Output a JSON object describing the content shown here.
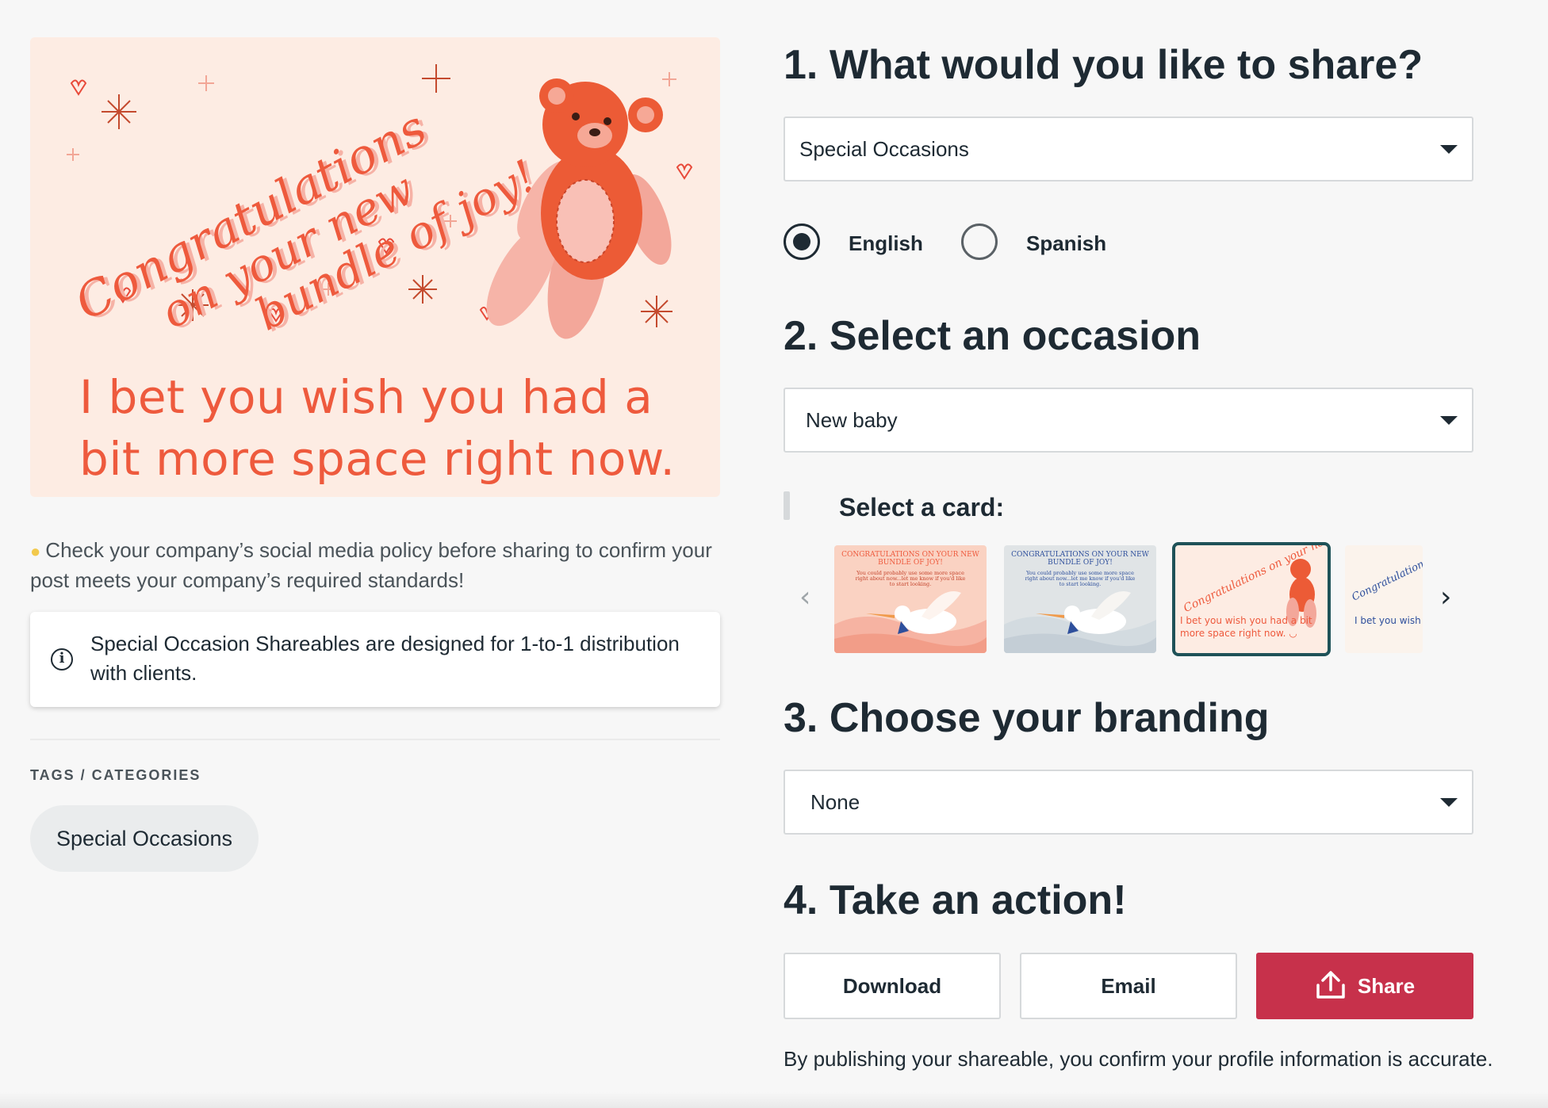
{
  "preview": {
    "headline_lines": [
      "Congratulations",
      "on your new",
      "bundle of joy!"
    ],
    "message": "I bet you wish you had a bit more space right now. ◡"
  },
  "tip": {
    "icon": "lightbulb-icon",
    "text": "Check your company’s social media policy before sharing to confirm your post meets your company’s required standards!"
  },
  "notice": {
    "icon": "info-icon",
    "text": "Special Occasion Shareables are designed for 1-to-1 distribution with clients."
  },
  "tags": {
    "label": "TAGS / CATEGORIES",
    "items": [
      "Special Occasions"
    ]
  },
  "steps": {
    "step1": {
      "heading": "1. What would you like to share?",
      "selected": "Special Occasions",
      "languages": [
        {
          "label": "English",
          "checked": true
        },
        {
          "label": "Spanish",
          "checked": false
        }
      ]
    },
    "step2": {
      "heading": "2. Select an occasion",
      "selected": "New baby",
      "select_card_label": "Select a card:",
      "cards": [
        {
          "title": "CONGRATULATIONS ON YOUR NEW BUNDLE OF JOY!",
          "body": "You could probably use some more space right about now...let me know if you'd like to start looking.",
          "selected": false
        },
        {
          "title": "CONGRATULATIONS ON YOUR NEW BUNDLE OF JOY!",
          "body": "You could probably use some more space right about now...let me know if you'd like to start looking.",
          "selected": false
        },
        {
          "title": "Congratulations on your new bundle of joy!",
          "body": "I bet you wish you had a bit more space right now. ◡",
          "selected": true
        },
        {
          "title": "Congratulations on your new bundle",
          "body": "I bet you wish more space ri",
          "selected": false
        }
      ]
    },
    "step3": {
      "heading": "3. Choose your branding",
      "selected": "None"
    },
    "step4": {
      "heading": "4. Take an action!",
      "download_label": "Download",
      "email_label": "Email",
      "share_label": "Share"
    }
  },
  "disclaimer": "By publishing your shareable, you confirm your profile information is accurate.",
  "colors": {
    "accent": "#c7314b",
    "card_coral": "#ee5a3d",
    "card_bg": "#fdece3",
    "selected_outline": "#1f5258",
    "text": "#1e2a33"
  }
}
